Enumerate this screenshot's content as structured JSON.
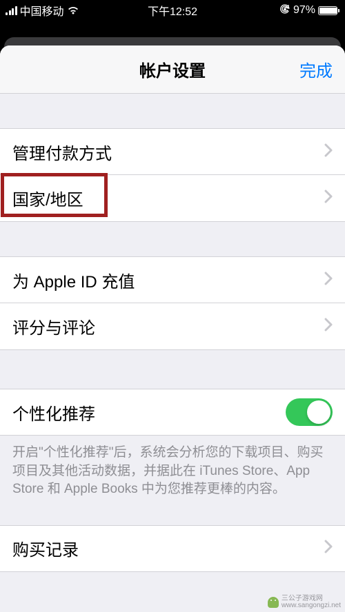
{
  "status": {
    "carrier": "中国移动",
    "time": "下午12:52",
    "battery_pct": "97%"
  },
  "header": {
    "title": "帐户设置",
    "done": "完成"
  },
  "cells": {
    "managePayment": "管理付款方式",
    "countryRegion": "国家/地区",
    "addFunds": "为 Apple ID 充值",
    "ratingsReviews": "评分与评论",
    "personalized": "个性化推荐",
    "purchaseHistory": "购买记录"
  },
  "footer": {
    "personalizedDesc": "开启\"个性化推荐\"后，系统会分析您的下载项目、购买项目及其他活动数据，并据此在 iTunes Store、App Store 和 Apple Books 中为您推荐更棒的内容。"
  },
  "watermark": {
    "line1": "三公子游戏网",
    "line2": "www.sangongzi.net"
  }
}
